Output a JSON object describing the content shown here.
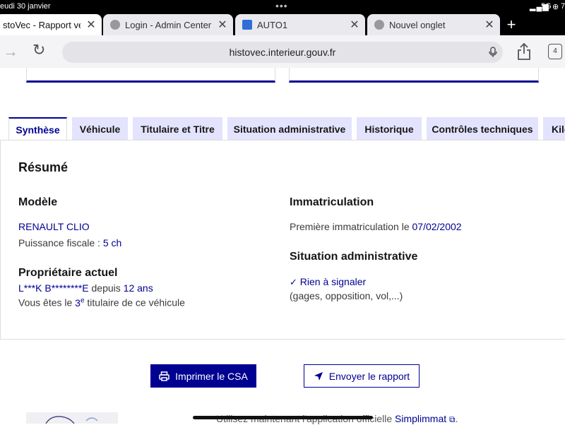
{
  "status_bar": {
    "date": "eudi 30 janvier",
    "signal": "5G",
    "battery": "7"
  },
  "tabs": [
    {
      "title": "stoVec - Rapport vendeur",
      "active": true
    },
    {
      "title": "Login - Admin Center",
      "active": false
    },
    {
      "title": "AUTO1",
      "active": false
    },
    {
      "title": "Nouvel onglet",
      "active": false
    }
  ],
  "toolbar": {
    "url": "histovec.interieur.gouv.fr",
    "tab_count": "4"
  },
  "nav_tabs": [
    "Synthèse",
    "Véhicule",
    "Titulaire et Titre",
    "Situation administrative",
    "Historique",
    "Contrôles techniques",
    "Kilo"
  ],
  "summary": {
    "title": "Résumé",
    "model": {
      "heading": "Modèle",
      "name": "RENAULT CLIO",
      "power_label": "Puissance fiscale :",
      "power_value": "5 ch"
    },
    "owner": {
      "heading": "Propriétaire actuel",
      "name": "L***K B********E",
      "since_word": "depuis",
      "duration": "12 ans",
      "rank_prefix": "Vous êtes le",
      "rank": "3",
      "rank_sup": "e",
      "rank_suffix": "titulaire de ce véhicule"
    },
    "registration": {
      "heading": "Immatriculation",
      "label": "Première immatriculation le",
      "date": "07/02/2002"
    },
    "admin": {
      "heading": "Situation administrative",
      "status": "Rien à signaler",
      "detail": "(gages, opposition, vol,...)"
    }
  },
  "actions": {
    "print": "Imprimer le CSA",
    "send": "Envoyer le rapport"
  },
  "footer": {
    "text": "Utilisez maintenant l'application officielle",
    "link": "Simplimmat"
  },
  "colors": {
    "brand_blue": "#000091",
    "tab_bg": "#e3e3fd"
  }
}
